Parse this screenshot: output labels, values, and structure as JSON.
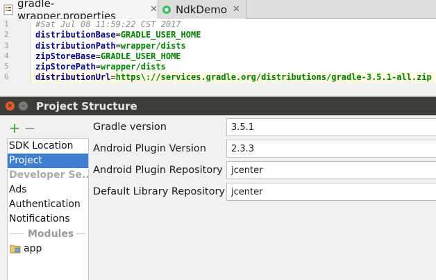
{
  "editor": {
    "tabs": [
      {
        "label": "gradle-wrapper.properties",
        "close": "✕",
        "active": true,
        "icon": "properties-file-icon"
      },
      {
        "label": "NdkDemo",
        "close": "✕",
        "active": false,
        "icon": "android-module-icon"
      }
    ],
    "line_numbers": [
      "1",
      "2",
      "3",
      "4",
      "5",
      "6"
    ],
    "lines": [
      {
        "comment": "#Sat Jul 08 11:59:22 CST 2017"
      },
      {
        "key": "distributionBase",
        "eq": "=",
        "value": "GRADLE_USER_HOME"
      },
      {
        "key": "distributionPath",
        "eq": "=",
        "value": "wrapper/dists"
      },
      {
        "key": "zipStoreBase",
        "eq": "=",
        "value": "GRADLE_USER_HOME"
      },
      {
        "key": "zipStorePath",
        "eq": "=",
        "value": "wrapper/dists"
      },
      {
        "key": "distributionUrl",
        "eq": "=",
        "value": "https\\://services.gradle.org/distributions/gradle-3.5.1-all.zip"
      }
    ]
  },
  "dialog": {
    "title": "Project Structure",
    "window_buttons": {
      "close": "×",
      "minimize": "–"
    },
    "toolbar": {
      "add": "+",
      "remove": "−"
    },
    "sidebar": {
      "items": [
        "SDK Location",
        "Project"
      ],
      "selected": "Project",
      "group_label": "Developer Se...",
      "group_items": [
        "Ads",
        "Authentication",
        "Notifications"
      ],
      "modules_label": "Modules",
      "modules": [
        "app"
      ]
    },
    "form": {
      "gradle_version": {
        "label": "Gradle version",
        "value": "3.5.1"
      },
      "android_plugin_version": {
        "label": "Android Plugin Version",
        "value": "2.3.3"
      },
      "android_plugin_repository": {
        "label": "Android Plugin Repository",
        "value": "jcenter"
      },
      "default_library_repository": {
        "label": "Default Library Repository",
        "value": "jcenter"
      }
    }
  },
  "colors": {
    "selection": "#3f7fcf",
    "titlebar": "#3d3c38",
    "close_button": "#e9592c",
    "add_icon": "#3aa33a",
    "property_key": "#000080",
    "property_value": "#008000"
  }
}
